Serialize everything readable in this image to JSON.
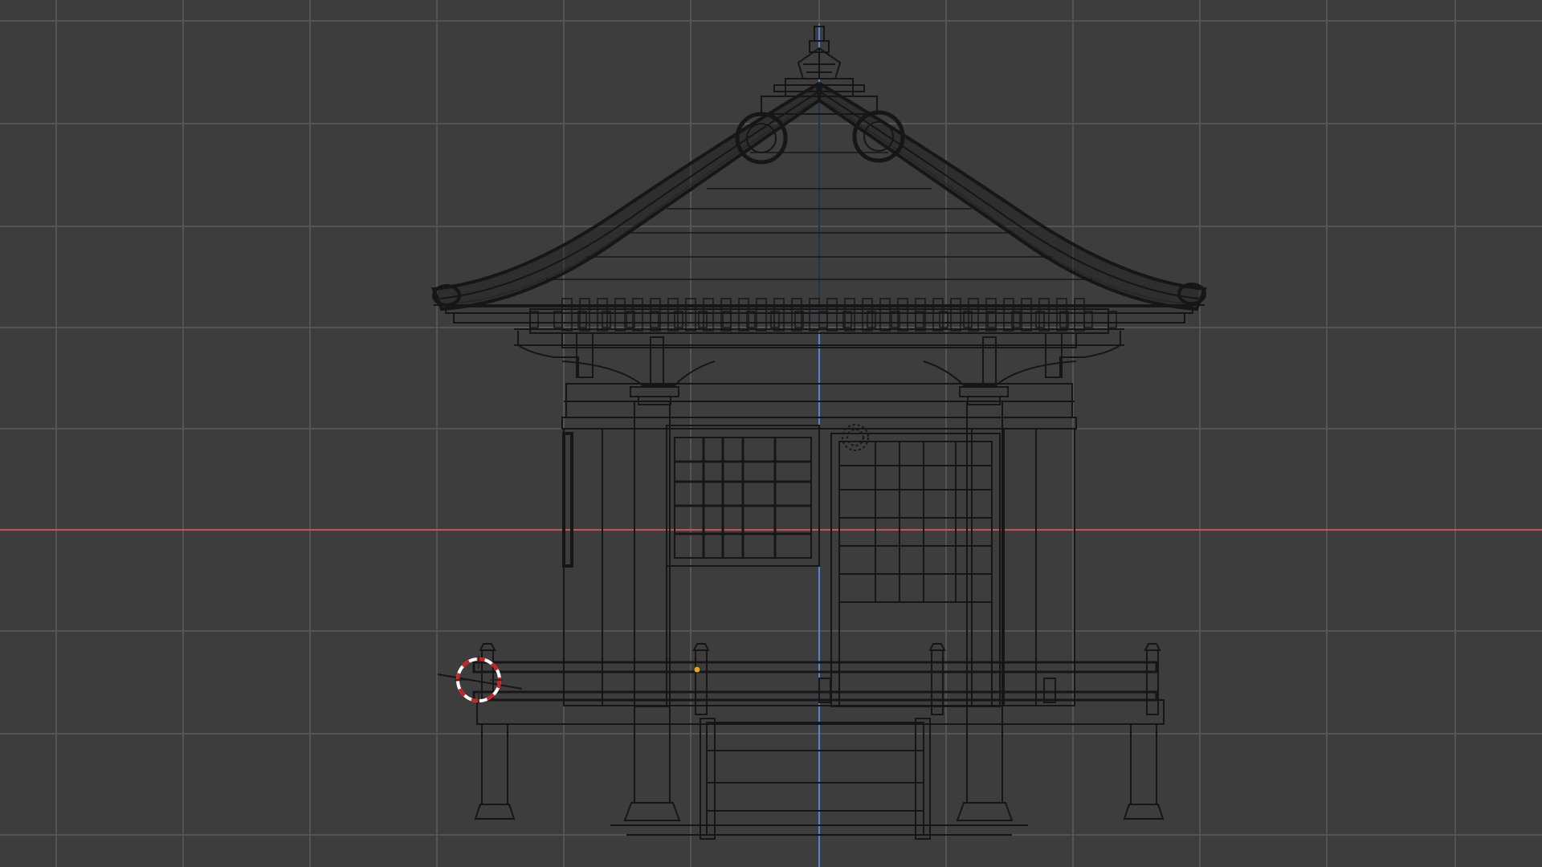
{
  "viewport": {
    "view": "front-orthographic-wireframe",
    "background_color": "#3d3d3d",
    "grid_color": "#545454",
    "x_axis_color": "#c8505a",
    "z_axis_color": "#4a88d8",
    "wire_color": "#161616",
    "grid_visible": true,
    "axis_x_visible": true,
    "axis_z_visible": true
  },
  "scene": {
    "object": "pavilion-model",
    "display_mode": "wireframe"
  },
  "cursor": {
    "icon": "3d-cursor-icon",
    "colors": [
      "#ffffff",
      "#d02020"
    ]
  },
  "origin": {
    "icon": "object-origin-dot",
    "color": "#f0a020"
  }
}
